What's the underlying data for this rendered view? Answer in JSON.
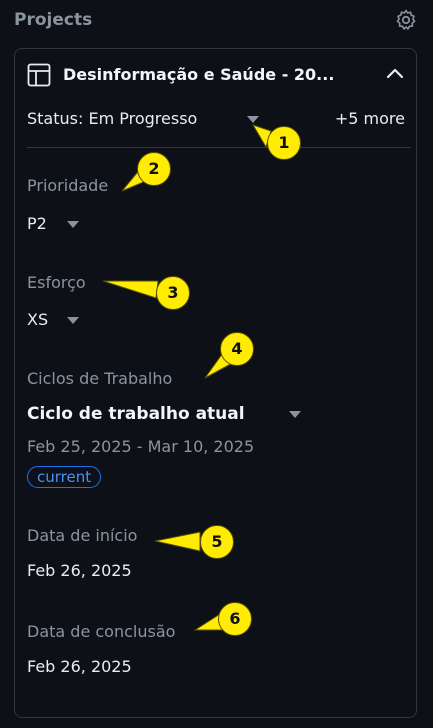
{
  "header": {
    "title": "Projects",
    "settings_icon": "gear-icon"
  },
  "project": {
    "title": "Desinformação e Saúde - 20...",
    "icon": "table-icon",
    "collapse_icon": "chevron-up-icon",
    "status": "Status: Em Progresso",
    "more": "+5 more"
  },
  "fields": {
    "priority": {
      "label": "Prioridade",
      "value": "P2"
    },
    "effort": {
      "label": "Esforço",
      "value": "XS"
    },
    "iteration": {
      "label": "Ciclos de Trabalho",
      "value": "Ciclo de trabalho atual",
      "dates": "Feb 25, 2025 - Mar 10, 2025",
      "badge": "current"
    },
    "start_date": {
      "label": "Data de início",
      "value": "Feb 26, 2025"
    },
    "end_date": {
      "label": "Data de conclusão",
      "value": "Feb 26, 2025"
    }
  },
  "callouts": [
    "1",
    "2",
    "3",
    "4",
    "5",
    "6"
  ],
  "colors": {
    "background": "#0d1117",
    "border": "#30363d",
    "muted": "#8b949e",
    "accent": "#4493f8",
    "callout": "#ffec00"
  }
}
